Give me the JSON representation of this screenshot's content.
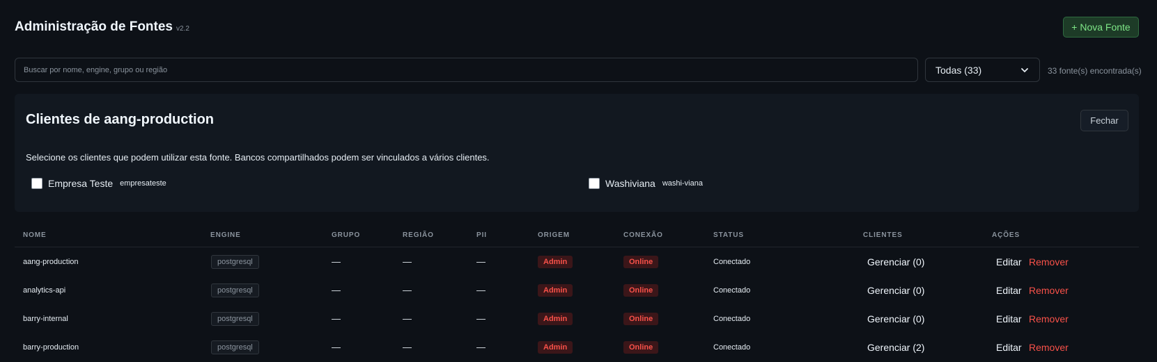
{
  "page": {
    "title": "Administração de Fontes",
    "version": "v2.2",
    "new_button": "+ Nova Fonte"
  },
  "filters": {
    "search_placeholder": "Buscar por nome, engine, grupo ou região",
    "search_value": "",
    "group_selected": "Todas (33)",
    "result_count": "33 fonte(s) encontrada(s)"
  },
  "clients_panel": {
    "title": "Clientes de aang-production",
    "close_label": "Fechar",
    "description": "Selecione os clientes que podem utilizar esta fonte. Bancos compartilhados podem ser vinculados a vários clientes.",
    "clients": [
      {
        "name": "Empresa Teste",
        "slug": "empresateste",
        "checked": false
      },
      {
        "name": "Washiviana",
        "slug": "washi-viana",
        "checked": false
      }
    ]
  },
  "table": {
    "columns": [
      "NOME",
      "ENGINE",
      "GRUPO",
      "REGIÃO",
      "PII",
      "ORIGEM",
      "CONEXÃO",
      "STATUS",
      "CLIENTES",
      "AÇÕES"
    ],
    "rows": [
      {
        "name": "aang-production",
        "engine": "postgresql",
        "group": "—",
        "region": "—",
        "pii": "—",
        "origin": "Admin",
        "connection": "Online",
        "status": "Conectado",
        "clients": "Gerenciar (0)",
        "edit": "Editar",
        "remove": "Remover"
      },
      {
        "name": "analytics-api",
        "engine": "postgresql",
        "group": "—",
        "region": "—",
        "pii": "—",
        "origin": "Admin",
        "connection": "Online",
        "status": "Conectado",
        "clients": "Gerenciar (0)",
        "edit": "Editar",
        "remove": "Remover"
      },
      {
        "name": "barry-internal",
        "engine": "postgresql",
        "group": "—",
        "region": "—",
        "pii": "—",
        "origin": "Admin",
        "connection": "Online",
        "status": "Conectado",
        "clients": "Gerenciar (0)",
        "edit": "Editar",
        "remove": "Remover"
      },
      {
        "name": "barry-production",
        "engine": "postgresql",
        "group": "—",
        "region": "—",
        "pii": "—",
        "origin": "Admin",
        "connection": "Online",
        "status": "Conectado",
        "clients": "Gerenciar (2)",
        "edit": "Editar",
        "remove": "Remover"
      }
    ]
  },
  "icons": {
    "select_chevron": "chevron-down-icon"
  },
  "colors": {
    "background": "#0d1117",
    "panel": "#121820",
    "accent_green": "#7ee787",
    "danger_red": "#f85149"
  }
}
